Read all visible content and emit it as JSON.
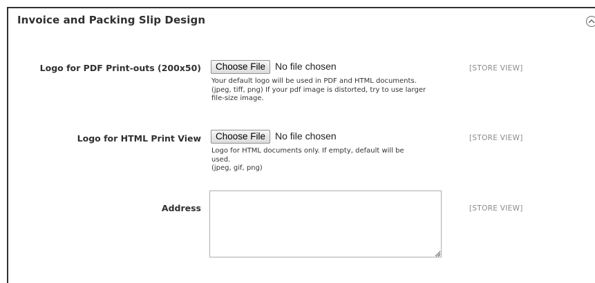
{
  "section": {
    "title": "Invoice and Packing Slip Design",
    "collapse_icon": "chevron-up-circle-icon"
  },
  "fields": [
    {
      "label": "Logo for PDF Print-outs (200x50)",
      "button_label": "Choose File",
      "status": "No file chosen",
      "note_lines": [
        "Your default logo will be used in PDF and HTML documents.",
        "(jpeg, tiff, png) If your pdf image is distorted, try to use larger",
        "file-size image."
      ],
      "scope": "[STORE VIEW]"
    },
    {
      "label": "Logo for HTML Print View",
      "button_label": "Choose File",
      "status": "No file chosen",
      "note_lines": [
        "Logo for HTML documents only. If empty, default will be",
        "used.",
        "(jpeg, gif, png)"
      ],
      "scope": "[STORE VIEW]"
    },
    {
      "label": "Address",
      "value": "",
      "scope": "[STORE VIEW]"
    }
  ],
  "colors": {
    "border": "#303030",
    "scope_text": "#8a8a8a",
    "label_text": "#303030"
  }
}
